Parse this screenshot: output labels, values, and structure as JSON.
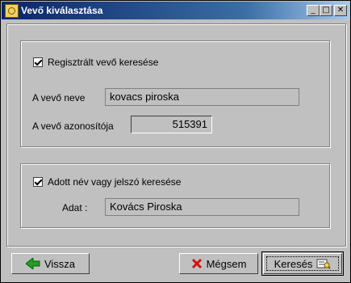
{
  "window": {
    "title": "Vevő kiválasztása",
    "controls": {
      "minimize": "_",
      "maximize": "□",
      "close": "✕"
    }
  },
  "registered_group": {
    "checkbox_label": "Regisztrált vevő keresése",
    "checked": true,
    "name_label": "A vevő neve",
    "name_value": "kovacs piroska",
    "id_label": "A vevő azonosítója",
    "id_value": "515391"
  },
  "keyword_group": {
    "checkbox_label": "Adott név vagy jelszó keresése",
    "checked": true,
    "data_label": "Adat :",
    "data_value": "Kovács Piroska"
  },
  "buttons": {
    "back_label": "Vissza",
    "cancel_label": "Mégsem",
    "search_label": "Keresés"
  },
  "icons": {
    "back": "green-arrow-left-icon",
    "cancel": "red-x-icon",
    "search": "search-document-icon"
  }
}
